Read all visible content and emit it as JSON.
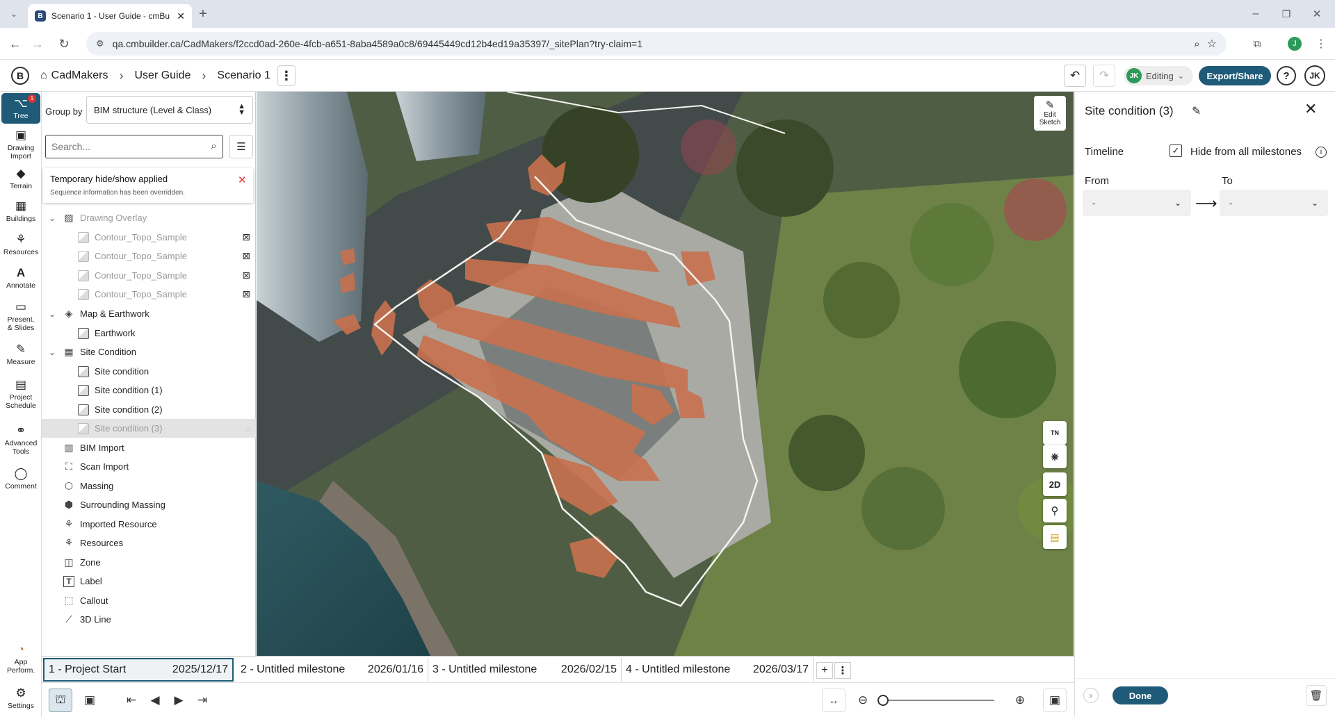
{
  "browser": {
    "tab_title": "Scenario 1 - User Guide - cmBu",
    "url": "qa.cmbuilder.ca/CadMakers/f2ccd0ad-260e-4fcb-a651-8aba4589a0c8/69445449cd12b4ed19a35397/_sitePlan?try-claim=1",
    "profile_initial": "J"
  },
  "header": {
    "logo": "B",
    "breadcrumb": [
      "CadMakers",
      "User Guide",
      "Scenario 1"
    ],
    "user_badge": "JK",
    "mode": "Editing",
    "export_label": "Export/Share",
    "help": "?",
    "avatar": "JK"
  },
  "rail": {
    "items": [
      {
        "label": "Tree",
        "icon": "tree-icon",
        "badge": "1",
        "active": true
      },
      {
        "label": "Drawing Import",
        "icon": "drawing-icon"
      },
      {
        "label": "Terrain",
        "icon": "terrain-icon"
      },
      {
        "label": "Buildings",
        "icon": "buildings-icon"
      },
      {
        "label": "Resources",
        "icon": "resources-icon"
      },
      {
        "label": "Annotate",
        "icon": "annotate-icon"
      },
      {
        "label": "Present. & Slides",
        "icon": "present-icon"
      },
      {
        "label": "Measure",
        "icon": "measure-icon"
      },
      {
        "label": "Project Schedule",
        "icon": "schedule-icon"
      },
      {
        "label": "Advanced Tools",
        "icon": "advanced-icon"
      },
      {
        "label": "Comment",
        "icon": "comment-icon"
      }
    ],
    "bottom": [
      {
        "label": "App Perform.",
        "icon": "gauge-icon"
      },
      {
        "label": "Settings",
        "icon": "gear-icon"
      }
    ]
  },
  "tree": {
    "group_by_label": "Group by",
    "group_by_value": "BIM structure (Level & Class)",
    "search_placeholder": "Search...",
    "notice_title": "Temporary hide/show applied",
    "notice_text": "Sequence information has been overridden.",
    "items": [
      {
        "label": "Drawing Overlay",
        "level": 0,
        "expanded": true,
        "faded": true
      },
      {
        "label": "Contour_Topo_Sample",
        "level": 1,
        "faded": true
      },
      {
        "label": "Contour_Topo_Sample",
        "level": 1,
        "faded": true
      },
      {
        "label": "Contour_Topo_Sample",
        "level": 1,
        "faded": true
      },
      {
        "label": "Contour_Topo_Sample",
        "level": 1,
        "faded": true
      },
      {
        "label": "Map & Earthwork",
        "level": 0,
        "expanded": true
      },
      {
        "label": "Earthwork",
        "level": 1
      },
      {
        "label": "Site Condition",
        "level": 0,
        "expanded": true
      },
      {
        "label": "Site condition",
        "level": 1
      },
      {
        "label": "Site condition (1)",
        "level": 1
      },
      {
        "label": "Site condition (2)",
        "level": 1
      },
      {
        "label": "Site condition (3)",
        "level": 1,
        "selected": true
      },
      {
        "label": "BIM Import",
        "level": 0
      },
      {
        "label": "Scan Import",
        "level": 0
      },
      {
        "label": "Massing",
        "level": 0
      },
      {
        "label": "Surrounding Massing",
        "level": 0
      },
      {
        "label": "Imported Resource",
        "level": 0
      },
      {
        "label": "Resources",
        "level": 0
      },
      {
        "label": "Zone",
        "level": 0
      },
      {
        "label": "Label",
        "level": 0
      },
      {
        "label": "Callout",
        "level": 0
      },
      {
        "label": "3D Line",
        "level": 0
      }
    ]
  },
  "map": {
    "edit_sketch": "Edit Sketch",
    "tools": [
      "TN",
      "⎈",
      "2D",
      "⚲",
      "▤"
    ]
  },
  "panel": {
    "title": "Site condition (3)",
    "timeline_label": "Timeline",
    "hide_label": "Hide from all milestones",
    "hide_checked": true,
    "from_label": "From",
    "to_label": "To",
    "from_value": "-",
    "to_value": "-",
    "done_label": "Done"
  },
  "milestones": [
    {
      "name": "1 - Project Start",
      "date": "2025/12/17",
      "active": true
    },
    {
      "name": "2 - Untitled milestone",
      "date": "2026/01/16"
    },
    {
      "name": "3 - Untitled milestone",
      "date": "2026/02/15"
    },
    {
      "name": "4 - Untitled milestone",
      "date": "2026/03/17"
    }
  ],
  "colors": {
    "accent": "#1f5b78",
    "selection": "#e3e3e3",
    "site_highlight": "#c8714e",
    "green": "#2e9a5a"
  }
}
